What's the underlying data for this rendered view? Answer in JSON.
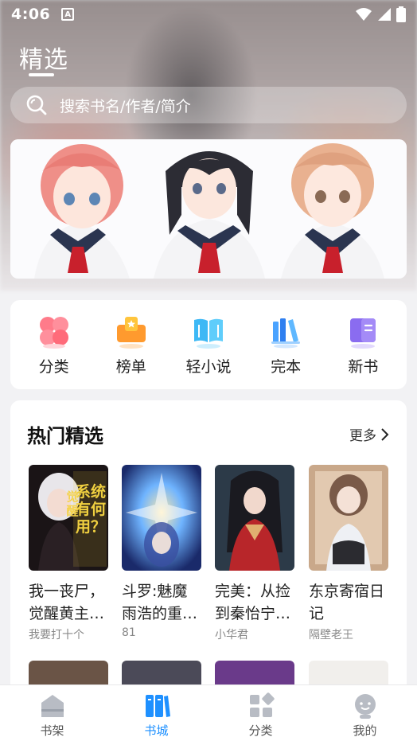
{
  "status_bar": {
    "time": "4:06",
    "indicator": "A"
  },
  "header": {
    "title": "精选"
  },
  "search": {
    "placeholder": "搜索书名/作者/简介"
  },
  "banner": {
    "image": "anime-girls-banner"
  },
  "quick_nav": [
    {
      "label": "分类",
      "icon": "category-clover-icon",
      "color": "#ff6b7a"
    },
    {
      "label": "榜单",
      "icon": "ranking-icon",
      "color": "#ff9a2e"
    },
    {
      "label": "轻小说",
      "icon": "open-book-icon",
      "color": "#3db8f5"
    },
    {
      "label": "完本",
      "icon": "books-stack-icon",
      "color": "#3d8df5"
    },
    {
      "label": "新书",
      "icon": "new-book-icon",
      "color": "#8a6cf0"
    }
  ],
  "hot": {
    "title": "热门精选",
    "more_label": "更多",
    "books": [
      {
        "title": "我一丧尸，觉醒黄主系统有何用？",
        "author": "我要打十个"
      },
      {
        "title": "斗罗:魅魔雨浩的重生之路",
        "author": "81"
      },
      {
        "title": "完美：从捡到秦怡宁开始",
        "author": "小华君"
      },
      {
        "title": "东京寄宿日记",
        "author": "隔壁老王"
      }
    ]
  },
  "tabs": [
    {
      "label": "书架",
      "icon": "bookshelf-icon",
      "active": false
    },
    {
      "label": "书城",
      "icon": "bookstore-icon",
      "active": true
    },
    {
      "label": "分类",
      "icon": "category-grid-icon",
      "active": false
    },
    {
      "label": "我的",
      "icon": "profile-icon",
      "active": false
    }
  ],
  "colors": {
    "accent": "#1e90ff",
    "inactive_tab": "#b8bcc4"
  }
}
